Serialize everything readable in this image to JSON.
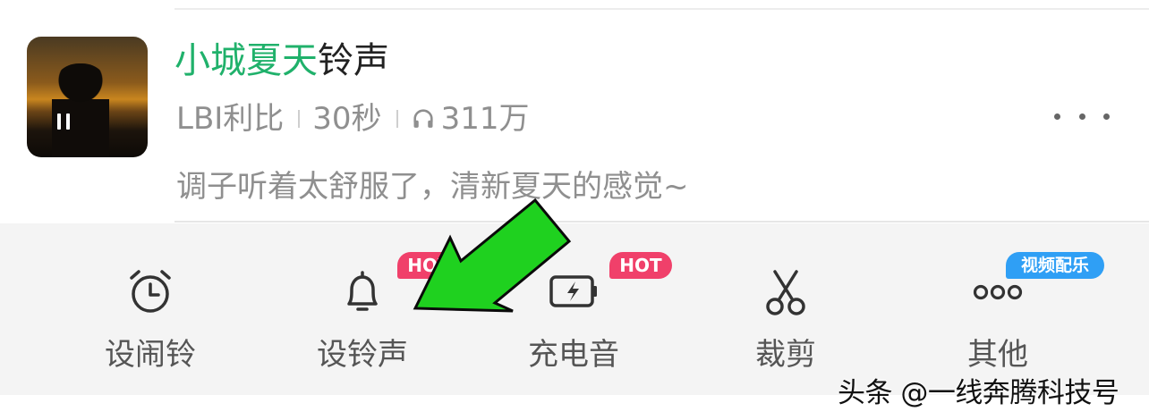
{
  "song": {
    "title_highlight": "小城夏天",
    "title_rest": "铃声",
    "artist": "LBI利比",
    "duration": "30秒",
    "plays": "311万",
    "description": "调子听着太舒服了，清新夏天的感觉~",
    "play_state_icon": "pause-icon"
  },
  "actions": [
    {
      "label": "设闹铃",
      "icon": "alarm-clock-icon"
    },
    {
      "label": "设铃声",
      "icon": "bell-icon",
      "badge": "HOT"
    },
    {
      "label": "充电音",
      "icon": "battery-charging-icon",
      "badge": "HOT"
    },
    {
      "label": "裁剪",
      "icon": "scissors-icon"
    },
    {
      "label": "其他",
      "icon": "more-circles-icon",
      "badge": "视频配乐"
    }
  ],
  "watermark": "头条 @一线奔腾科技号",
  "colors": {
    "highlight": "#20b16b",
    "hot_badge": "#f0406a",
    "video_badge": "#2f9ff5",
    "arrow": "#1fd11f",
    "action_bar_bg": "#f4f4f4"
  }
}
